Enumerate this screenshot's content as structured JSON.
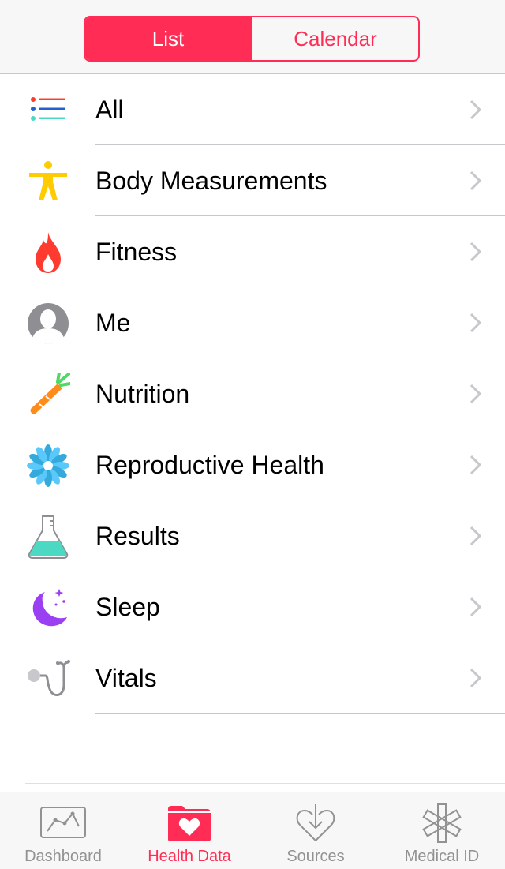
{
  "segmented": {
    "active": "List",
    "inactive": "Calendar"
  },
  "categories": [
    {
      "label": "All",
      "icon": "list-icon"
    },
    {
      "label": "Body Measurements",
      "icon": "body-figure-icon"
    },
    {
      "label": "Fitness",
      "icon": "flame-icon"
    },
    {
      "label": "Me",
      "icon": "person-icon"
    },
    {
      "label": "Nutrition",
      "icon": "carrot-icon"
    },
    {
      "label": "Reproductive Health",
      "icon": "flower-icon"
    },
    {
      "label": "Results",
      "icon": "flask-icon"
    },
    {
      "label": "Sleep",
      "icon": "moon-icon"
    },
    {
      "label": "Vitals",
      "icon": "stethoscope-icon"
    }
  ],
  "tabbar": {
    "items": [
      {
        "label": "Dashboard",
        "icon": "chart-icon",
        "active": false
      },
      {
        "label": "Health Data",
        "icon": "heart-folder-icon",
        "active": true
      },
      {
        "label": "Sources",
        "icon": "heart-download-icon",
        "active": false
      },
      {
        "label": "Medical ID",
        "icon": "medical-star-icon",
        "active": false
      }
    ]
  },
  "colors": {
    "accent": "#ff2d55",
    "inactive_tab": "#929292",
    "separator": "#c8c7cc"
  }
}
